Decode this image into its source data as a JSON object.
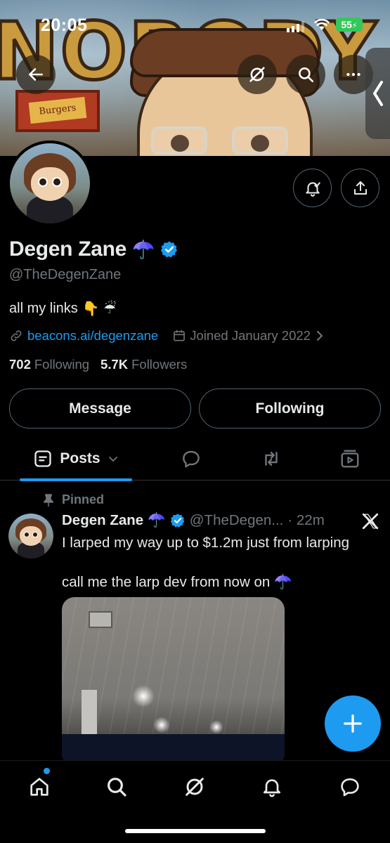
{
  "status_bar": {
    "time": "20:05",
    "battery": "55"
  },
  "banner": {
    "word": "NOBODY",
    "sign_text": "Burgers"
  },
  "profile": {
    "display_name": "Degen Zane",
    "name_emoji": "☂️",
    "handle": "@TheDegenZane",
    "bio": "all my links",
    "bio_emoji": "👇 ☔",
    "link": "beacons.ai/degenzane",
    "joined": "Joined January 2022",
    "following_count": "702",
    "following_label": "Following",
    "followers_count": "5.7K",
    "followers_label": "Followers"
  },
  "actions": {
    "message": "Message",
    "following": "Following"
  },
  "tabs": {
    "posts": "Posts"
  },
  "tweet": {
    "pinned_label": "Pinned",
    "author": "Degen Zane",
    "author_emoji": "☂️",
    "handle": "@TheDegen...",
    "time": "· 22m",
    "line1": "I larped my way up to $1.2m just from larping",
    "line2": "call me the larp dev from now on",
    "line2_emoji": "☂️"
  },
  "colors": {
    "accent": "#1d9bf0",
    "background": "#000000",
    "muted": "#71767b",
    "text": "#e7e9ea"
  },
  "icons": {
    "header": [
      "back-arrow-icon",
      "grok-icon",
      "search-icon",
      "more-icon",
      "chevron-left-icon"
    ],
    "profile": [
      "notification-bell-icon",
      "share-icon",
      "verified-badge-icon",
      "link-icon",
      "calendar-icon",
      "chevron-right-icon"
    ],
    "tabs": [
      "posts-icon",
      "chevron-down-icon",
      "reply-icon",
      "repost-icon",
      "media-icon"
    ],
    "tweet": [
      "pin-icon",
      "verified-badge-icon",
      "x-logo-icon"
    ],
    "nav": [
      "home-icon",
      "search-icon",
      "grok-icon",
      "notifications-icon",
      "messages-icon"
    ],
    "fab": "plus-icon"
  }
}
